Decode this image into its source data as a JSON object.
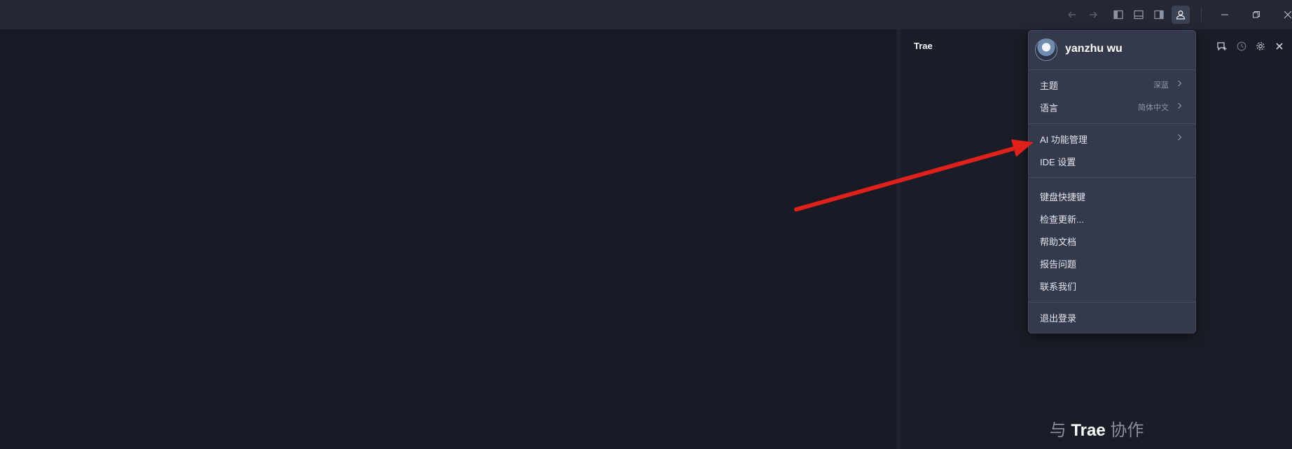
{
  "titlebar": {
    "icons": [
      "arrow-left-icon",
      "arrow-right-icon",
      "left-sidebar-toggle-icon",
      "bottom-panel-toggle-icon",
      "right-sidebar-toggle-icon",
      "account-icon"
    ],
    "window_buttons": [
      "minimize-icon",
      "restore-icon",
      "close-icon"
    ]
  },
  "side_panel": {
    "title": "Trae",
    "icons": [
      "new-chat-icon",
      "history-icon",
      "settings-gear-icon",
      "close-panel-icon"
    ],
    "collab_prefix": "与",
    "collab_brand": "Trae",
    "collab_suffix": "协作"
  },
  "account_menu": {
    "user_name": "yanzhu wu",
    "items": [
      {
        "label": "主题",
        "value": "深蓝",
        "has_submenu": true
      },
      {
        "label": "语言",
        "value": "简体中文",
        "has_submenu": true
      },
      {
        "label": "AI 功能管理",
        "value": "",
        "has_submenu": true
      },
      {
        "label": "IDE 设置",
        "value": "",
        "has_submenu": false
      },
      {
        "label": "键盘快捷键",
        "value": "",
        "has_submenu": false
      },
      {
        "label": "检查更新...",
        "value": "",
        "has_submenu": false
      },
      {
        "label": "帮助文档",
        "value": "",
        "has_submenu": false
      },
      {
        "label": "报告问题",
        "value": "",
        "has_submenu": false
      },
      {
        "label": "联系我们",
        "value": "",
        "has_submenu": false
      },
      {
        "label": "退出登录",
        "value": "",
        "has_submenu": false
      }
    ]
  },
  "annotation": {
    "arrow_color": "#e0201b",
    "points_to": "AI 功能管理"
  },
  "colors": {
    "background": "#181b25",
    "titlebar": "#242834",
    "menu": "#343a4b",
    "accent_red": "#e0201b"
  }
}
